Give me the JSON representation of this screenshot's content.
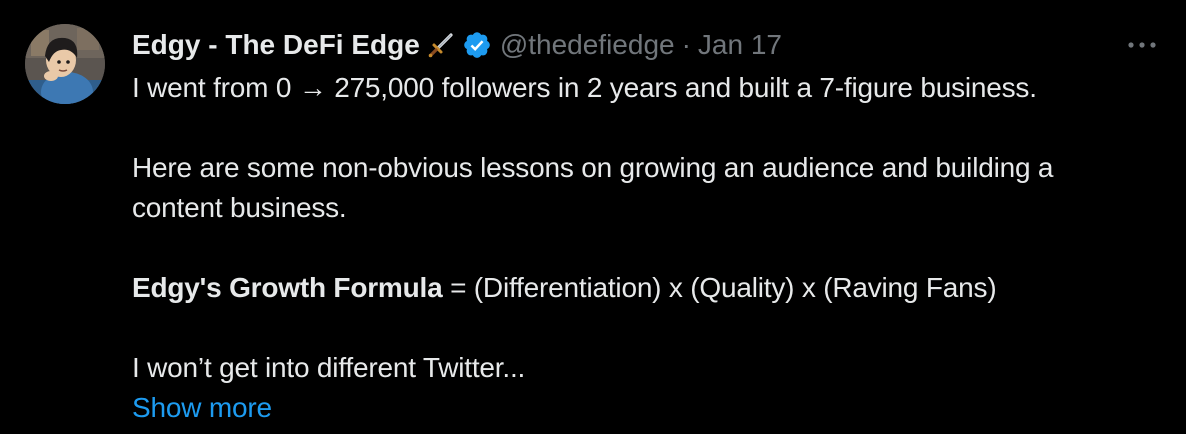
{
  "tweet": {
    "author": {
      "display_name": "Edgy - The DeFi Edge",
      "handle": "@thedefiedge",
      "avatar": "cartoon-avatar",
      "badges": [
        "sword-emoji",
        "verified-badge-icon"
      ]
    },
    "separator": "·",
    "date": "Jan 17",
    "menu_icon": "more-horizontal-icon",
    "text": {
      "line1": "I went from 0 → 275,000 followers in 2 years and built a 7-figure business.",
      "line2": "Here are some non-obvious lessons on growing an audience and building a",
      "line3": "content business.",
      "formula_bold": "Edgy's Growth Formula",
      "formula_rest": " = (Differentiation) x (Quality) x (Raving Fans)",
      "line5": "I won’t get into different Twitter..."
    },
    "show_more_label": "Show more"
  },
  "colors": {
    "background": "#000000",
    "primary_text": "#e7e9ea",
    "secondary_text": "#71767b",
    "link": "#1d9bf0",
    "verified": "#1d9bf0"
  }
}
